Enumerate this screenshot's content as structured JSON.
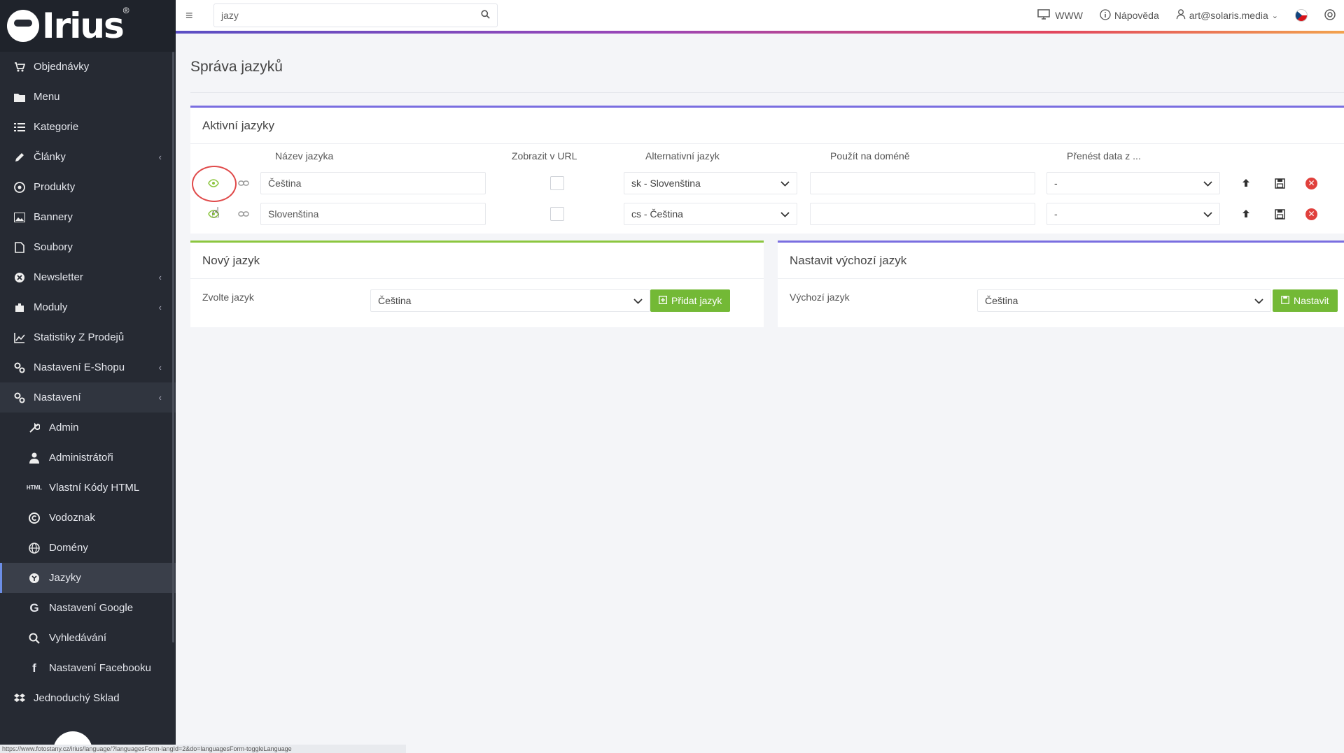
{
  "brand": {
    "name": "Irius",
    "reg": "®"
  },
  "topbar": {
    "search_value": "jazy",
    "www_label": "WWW",
    "help_label": "Nápověda",
    "user_label": "art@solaris.media"
  },
  "sidebar": {
    "items": [
      {
        "label": "Objednávky"
      },
      {
        "label": "Menu"
      },
      {
        "label": "Kategorie"
      },
      {
        "label": "Články"
      },
      {
        "label": "Produkty"
      },
      {
        "label": "Bannery"
      },
      {
        "label": "Soubory"
      },
      {
        "label": "Newsletter"
      },
      {
        "label": "Moduly"
      },
      {
        "label": "Statistiky Z Prodejů"
      },
      {
        "label": "Nastavení E-Shopu"
      },
      {
        "label": "Nastavení"
      }
    ],
    "sub": [
      {
        "label": "Admin"
      },
      {
        "label": "Administrátoři"
      },
      {
        "label": "Vlastní Kódy HTML"
      },
      {
        "label": "Vodoznak"
      },
      {
        "label": "Domény"
      },
      {
        "label": "Jazyky"
      },
      {
        "label": "Nastavení Google"
      },
      {
        "label": "Vyhledávání"
      },
      {
        "label": "Nastavení Facebooku"
      }
    ],
    "last": {
      "label": "Jednoduchý Sklad"
    }
  },
  "page": {
    "title": "Správa jazyků"
  },
  "active_languages": {
    "title": "Aktivní jazyky",
    "headers": [
      "Název jazyka",
      "Zobrazit v URL",
      "Alternativní jazyk",
      "Použít na doméně",
      "Přenést data z ..."
    ],
    "rows": [
      {
        "name": "Čeština",
        "alt": "sk - Slovenština",
        "domain": "",
        "transfer": "-"
      },
      {
        "name": "Slovenština",
        "alt": "cs - Čeština",
        "domain": "",
        "transfer": "-"
      }
    ]
  },
  "new_language": {
    "title": "Nový jazyk",
    "label": "Zvolte jazyk",
    "value": "Čeština",
    "button": "Přidat jazyk"
  },
  "default_language": {
    "title": "Nastavit výchozí jazyk",
    "label": "Výchozí jazyk",
    "value": "Čeština",
    "button": "Nastavit"
  },
  "status_url": "https://www.fotostany.cz/irius/language/?languagesForm-langId=2&do=languagesForm-toggleLanguage",
  "colors": {
    "accent": "#7a6ee0",
    "green": "#73b936",
    "sidebar": "#262a33",
    "danger": "#e0403c"
  }
}
